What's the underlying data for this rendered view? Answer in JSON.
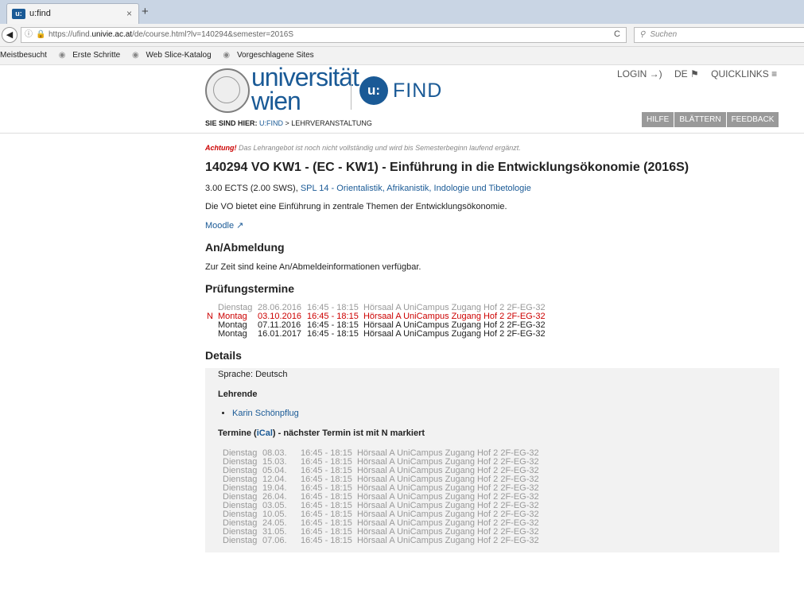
{
  "browser": {
    "tab_title": "u:find",
    "tab_favicon": "u:",
    "close_glyph": "×",
    "new_tab_glyph": "+",
    "url_prefix": "https://ufind.",
    "url_domain": "univie.ac.at",
    "url_path": "/de/course.html?lv=140294&semester=2016S",
    "search_placeholder": "Suchen",
    "bookmarks": [
      "Meistbesucht",
      "Erste Schritte",
      "Web Slice-Katalog",
      "Vorgeschlagene Sites"
    ]
  },
  "header": {
    "logo_line1": "universität",
    "logo_line2": "wien",
    "badge": "u:",
    "find": "FIND",
    "login": "LOGIN →)",
    "lang": "DE ⚑",
    "quicklinks": "QUICKLINKS ≡",
    "breadcrumb_label": "SIE SIND HIER:",
    "breadcrumb_link": "U:FIND",
    "breadcrumb_current": "> LEHRVERANSTALTUNG",
    "buttons": [
      "HILFE",
      "BLÄTTERN",
      "FEEDBACK"
    ]
  },
  "course": {
    "warning_label": "Achtung!",
    "warning_text": " Das Lehrangebot ist noch nicht vollständig und wird bis Semesterbeginn laufend ergänzt.",
    "title": "140294 VO KW1 - (EC - KW1) - Einführung in die Entwicklungsökonomie (2016S)",
    "ects": "3.00 ECTS (2.00 SWS), ",
    "spl": "SPL 14 - Orientalistik, Afrikanistik, Indologie und Tibetologie",
    "description": "Die VO bietet eine Einführung in zentrale Themen der Entwicklungsökonomie.",
    "moodle": "Moodle ↗",
    "registration_heading": "An/Abmeldung",
    "registration_text": "Zur Zeit sind keine An/Abmeldeinformationen verfügbar.",
    "exams_heading": "Prüfungstermine",
    "exams": [
      {
        "mark": "",
        "day": "Dienstag",
        "date": "28.06.2016",
        "time": "16:45 - 18:15",
        "room": "Hörsaal A UniCampus Zugang Hof 2 2F-EG-32",
        "state": "past"
      },
      {
        "mark": "N",
        "day": "Montag",
        "date": "03.10.2016",
        "time": "16:45 - 18:15",
        "room": "Hörsaal A UniCampus Zugang Hof 2 2F-EG-32",
        "state": "next"
      },
      {
        "mark": "",
        "day": "Montag",
        "date": "07.11.2016",
        "time": "16:45 - 18:15",
        "room": "Hörsaal A UniCampus Zugang Hof 2 2F-EG-32",
        "state": "future"
      },
      {
        "mark": "",
        "day": "Montag",
        "date": "16.01.2017",
        "time": "16:45 - 18:15",
        "room": "Hörsaal A UniCampus Zugang Hof 2 2F-EG-32",
        "state": "future"
      }
    ],
    "details_heading": "Details",
    "language": "Sprache: Deutsch",
    "lecturers_heading": "Lehrende",
    "lecturer": "Karin Schönpflug",
    "terms_heading_pre": "Termine (",
    "terms_ical": "iCal",
    "terms_heading_post": ") - nächster Termin ist mit N markiert",
    "terms": [
      {
        "day": "Dienstag",
        "date": "08.03.",
        "time": "16:45 - 18:15",
        "room": "Hörsaal A UniCampus Zugang Hof 2 2F-EG-32"
      },
      {
        "day": "Dienstag",
        "date": "15.03.",
        "time": "16:45 - 18:15",
        "room": "Hörsaal A UniCampus Zugang Hof 2 2F-EG-32"
      },
      {
        "day": "Dienstag",
        "date": "05.04.",
        "time": "16:45 - 18:15",
        "room": "Hörsaal A UniCampus Zugang Hof 2 2F-EG-32"
      },
      {
        "day": "Dienstag",
        "date": "12.04.",
        "time": "16:45 - 18:15",
        "room": "Hörsaal A UniCampus Zugang Hof 2 2F-EG-32"
      },
      {
        "day": "Dienstag",
        "date": "19.04.",
        "time": "16:45 - 18:15",
        "room": "Hörsaal A UniCampus Zugang Hof 2 2F-EG-32"
      },
      {
        "day": "Dienstag",
        "date": "26.04.",
        "time": "16:45 - 18:15",
        "room": "Hörsaal A UniCampus Zugang Hof 2 2F-EG-32"
      },
      {
        "day": "Dienstag",
        "date": "03.05.",
        "time": "16:45 - 18:15",
        "room": "Hörsaal A UniCampus Zugang Hof 2 2F-EG-32"
      },
      {
        "day": "Dienstag",
        "date": "10.05.",
        "time": "16:45 - 18:15",
        "room": "Hörsaal A UniCampus Zugang Hof 2 2F-EG-32"
      },
      {
        "day": "Dienstag",
        "date": "24.05.",
        "time": "16:45 - 18:15",
        "room": "Hörsaal A UniCampus Zugang Hof 2 2F-EG-32"
      },
      {
        "day": "Dienstag",
        "date": "31.05.",
        "time": "16:45 - 18:15",
        "room": "Hörsaal A UniCampus Zugang Hof 2 2F-EG-32"
      },
      {
        "day": "Dienstag",
        "date": "07.06.",
        "time": "16:45 - 18:15",
        "room": "Hörsaal A UniCampus Zugang Hof 2 2F-EG-32"
      }
    ]
  },
  "colors": {
    "brand": "#1a5a96",
    "next": "#cc0000",
    "past": "#999999"
  }
}
